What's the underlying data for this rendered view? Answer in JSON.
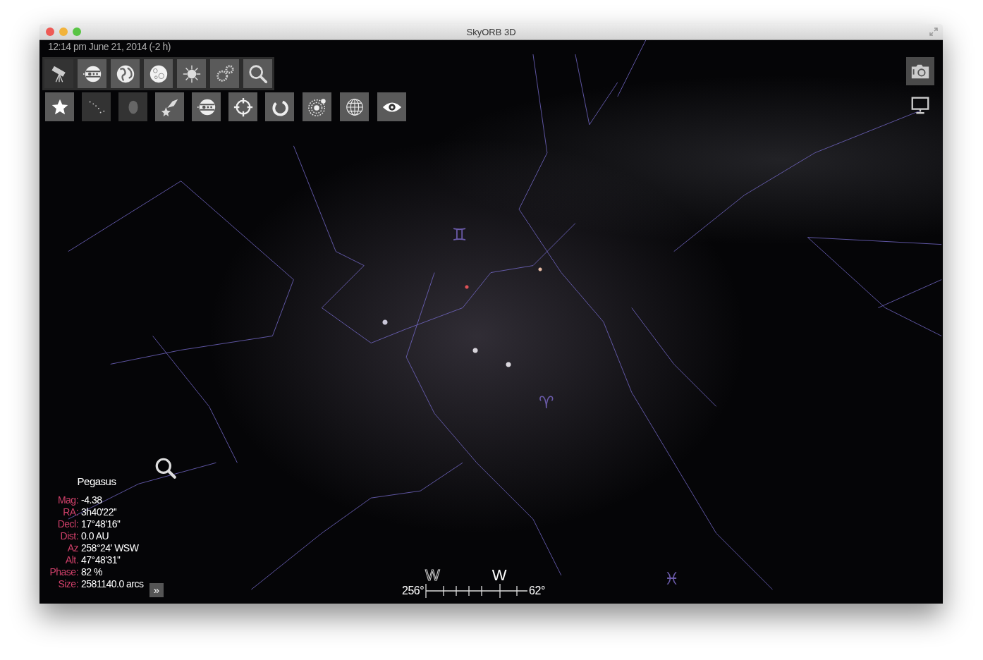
{
  "window": {
    "title": "SkyORB 3D"
  },
  "datetime": "12:14 pm June 21, 2014 (-2 h)",
  "toolbar_top": [
    {
      "kind": "telescope",
      "on": false
    },
    {
      "kind": "planet",
      "on": true
    },
    {
      "kind": "earth",
      "on": true
    },
    {
      "kind": "moon",
      "on": true
    },
    {
      "kind": "sun",
      "on": true
    },
    {
      "kind": "gears",
      "on": true
    },
    {
      "kind": "search",
      "on": true
    }
  ],
  "toolbar_bottom": [
    {
      "kind": "star",
      "on": true
    },
    {
      "kind": "constellation",
      "on": false
    },
    {
      "kind": "nebula",
      "on": false
    },
    {
      "kind": "comet",
      "on": true
    },
    {
      "kind": "planet",
      "on": true
    },
    {
      "kind": "crosshair",
      "on": true
    },
    {
      "kind": "rotate",
      "on": true
    },
    {
      "kind": "orbits",
      "on": true
    },
    {
      "kind": "grid",
      "on": true
    },
    {
      "kind": "eye",
      "on": true
    }
  ],
  "side_buttons": [
    {
      "kind": "camera"
    },
    {
      "kind": "monitor"
    }
  ],
  "sky_symbols": [
    "♊",
    "♈",
    "♓"
  ],
  "info": {
    "name": "Pegasus",
    "rows": [
      {
        "label": "Mag:",
        "value": "-4.38"
      },
      {
        "label": "RA:",
        "value": "3h40'22''"
      },
      {
        "label": "Decl:",
        "value": "17°48'16''"
      },
      {
        "label": "Dist:",
        "value": "0.0 AU"
      },
      {
        "label": "Az",
        "value": "258°24' WSW"
      },
      {
        "label": "Alt.",
        "value": "47°48'31''"
      },
      {
        "label": "Phase:",
        "value": "82 %"
      },
      {
        "label": "Size:",
        "value": "2581140.0 arcs"
      }
    ],
    "more": "»"
  },
  "compass": {
    "left": "256°",
    "right": "62°",
    "marks": [
      {
        "text": "W",
        "faint": true
      },
      {
        "text": "W",
        "faint": false
      }
    ]
  }
}
